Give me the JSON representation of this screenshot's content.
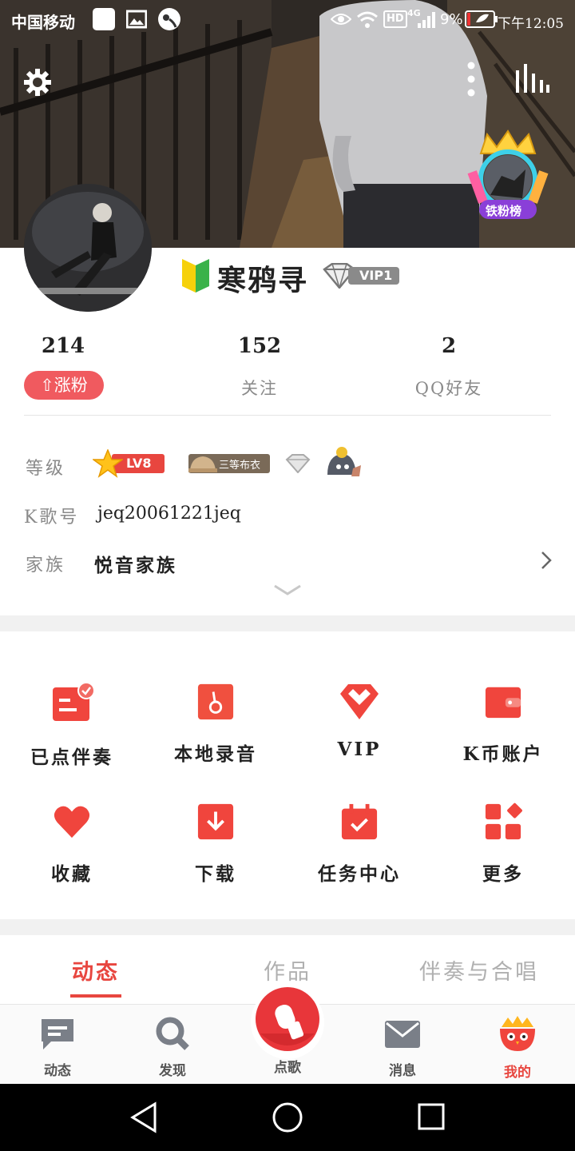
{
  "status_bar": {
    "carrier": "中国移动",
    "network": "4G",
    "hd": "HD",
    "battery_percent": "9%",
    "time": "下午12:05"
  },
  "header": {
    "settings_icon": "gear-icon",
    "more_icon": "vertical-dots-icon",
    "stats_icon": "bar-chart-icon",
    "fan_badge_label": "铁粉榜"
  },
  "profile": {
    "name": "寒鸦寻",
    "vip_label": "VIP1",
    "fans_count": "214",
    "fans_button_label": "涨粉",
    "following_count": "152",
    "following_label": "关注",
    "qq_friends_count": "2",
    "qq_friends_label": "QQ好友"
  },
  "info": {
    "level_label": "等级",
    "level_badge": "LV8",
    "rank_badge": "三等布衣",
    "kge_label": "K歌号",
    "kge_value": "jeq20061221jeq",
    "family_label": "家族",
    "family_value": "悦音家族"
  },
  "grid": [
    {
      "label": "已点伴奏",
      "icon": "accompaniment-icon"
    },
    {
      "label": "本地录音",
      "icon": "local-recording-icon"
    },
    {
      "label": "VIP",
      "icon": "vip-diamond-icon"
    },
    {
      "label": "K币账户",
      "icon": "wallet-icon"
    },
    {
      "label": "收藏",
      "icon": "heart-icon"
    },
    {
      "label": "下载",
      "icon": "download-icon"
    },
    {
      "label": "任务中心",
      "icon": "calendar-check-icon"
    },
    {
      "label": "更多",
      "icon": "more-apps-icon"
    }
  ],
  "tabs": [
    {
      "label": "动态",
      "active": true
    },
    {
      "label": "作品",
      "active": false
    },
    {
      "label": "伴奏与合唱",
      "active": false
    }
  ],
  "bottom_nav": [
    {
      "label": "动态",
      "icon": "message-icon"
    },
    {
      "label": "发现",
      "icon": "search-icon"
    },
    {
      "label": "点歌",
      "icon": "mic-icon"
    },
    {
      "label": "消息",
      "icon": "mail-icon"
    },
    {
      "label": "我的",
      "icon": "mascot-icon",
      "active": true
    }
  ],
  "colors": {
    "accent": "#e8463f",
    "fans_button": "#f05a5f"
  }
}
